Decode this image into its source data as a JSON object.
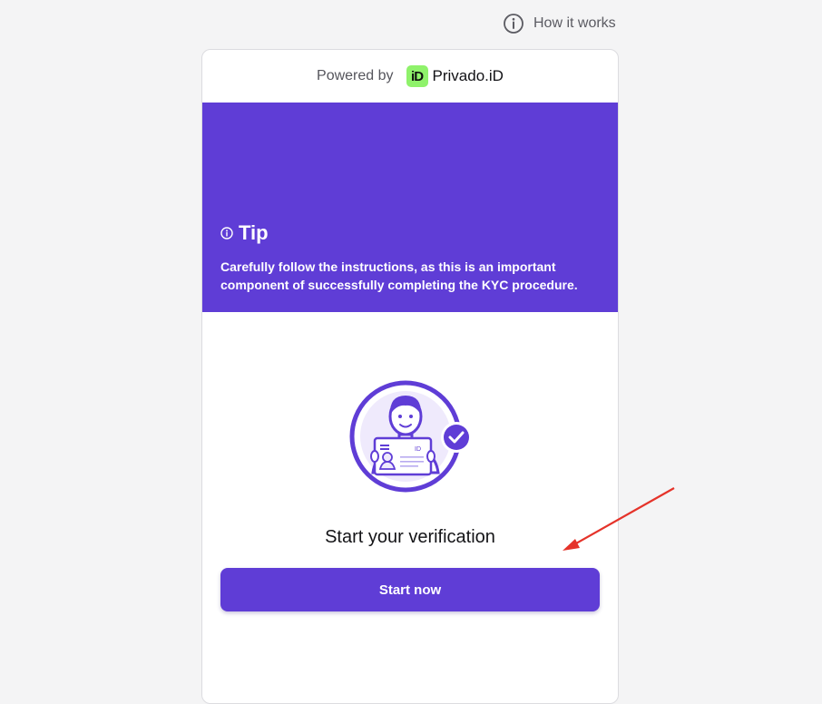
{
  "header": {
    "how_it_works_label": "How it works",
    "how_it_works_icon": "info-circle-icon"
  },
  "card": {
    "powered_by_label": "Powered by",
    "brand_logo_text": "iD",
    "brand_name": "Privado.iD",
    "tip": {
      "icon": "info-icon",
      "title": "Tip",
      "text": "Carefully follow the instructions, as this is an important component of successfully completing the KYC procedure."
    },
    "illustration": {
      "icon": "id-card-verification-illustration",
      "card_label": "ID"
    },
    "heading": "Start your verification",
    "start_button_label": "Start now"
  },
  "colors": {
    "accent": "#5f3dd6",
    "brand_logo_bg": "#8ff26b",
    "page_bg": "#f4f4f5",
    "annotation_arrow": "#e5332a"
  }
}
